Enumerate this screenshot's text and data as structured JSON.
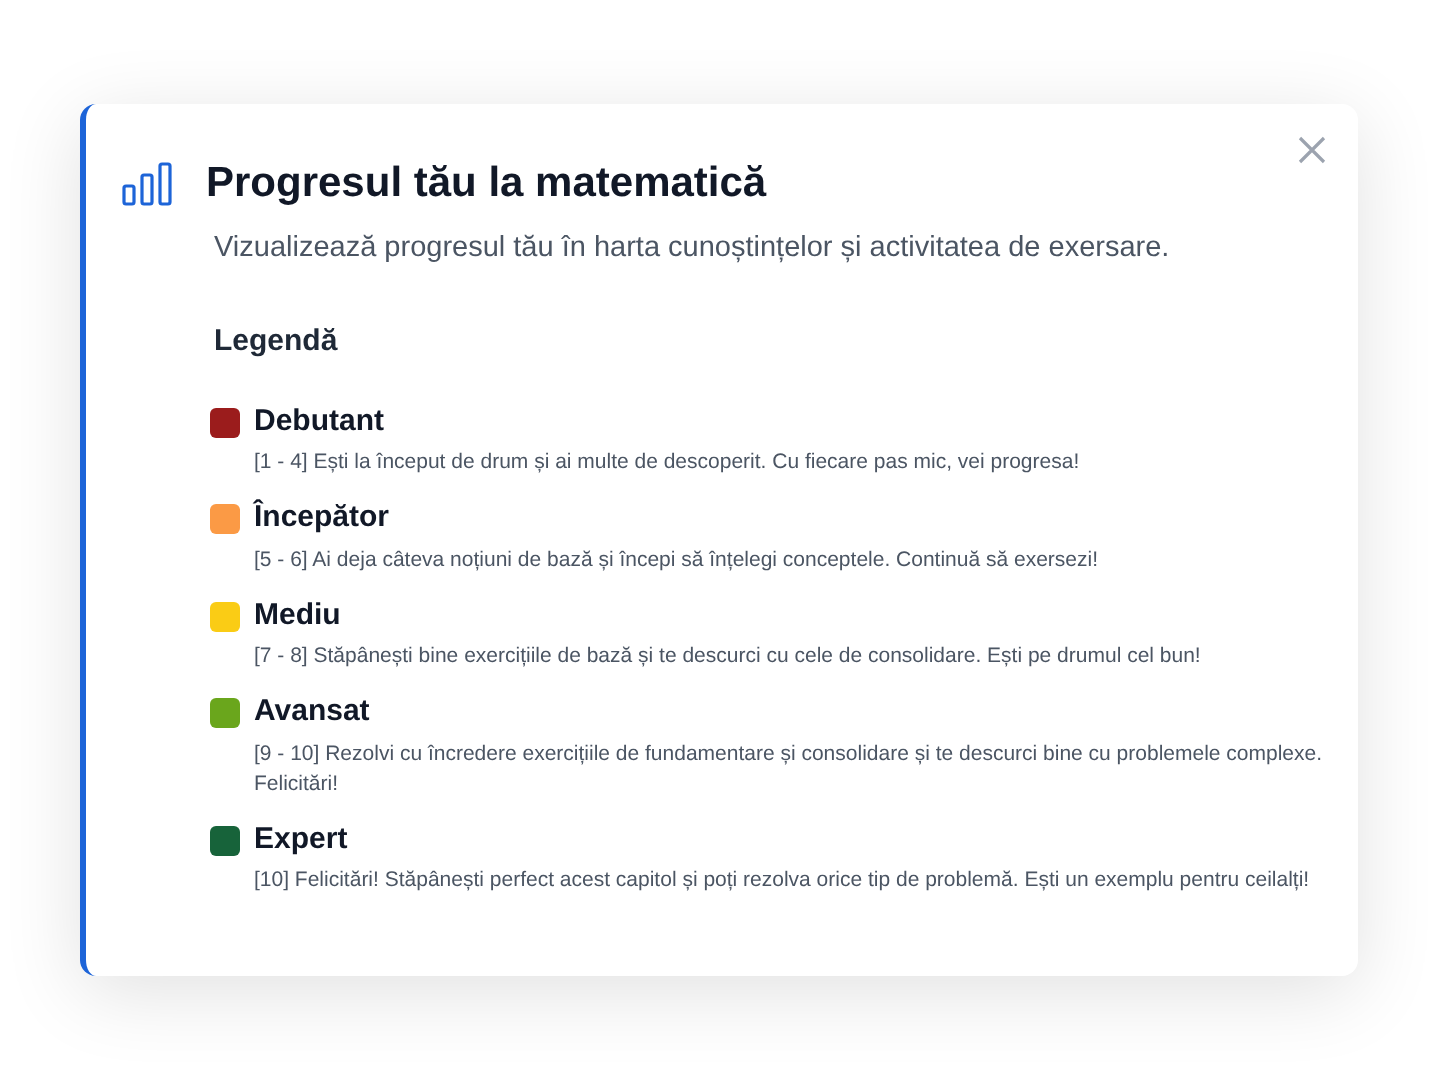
{
  "dialog": {
    "title": "Progresul tău la matematică",
    "subtitle": "Vizualizează progresul tău în harta cunoștințelor și activitatea de exersare.",
    "legend_title": "Legendă",
    "levels": [
      {
        "name": "Debutant",
        "color": "#9b1c1c",
        "description": "[1 - 4] Ești la început de drum și ai multe de descoperit. Cu fiecare pas mic, vei progresa!"
      },
      {
        "name": "Începător",
        "color": "#fb9a45",
        "description": "[5 - 6] Ai deja câteva noțiuni de bază și începi să înțelegi conceptele. Continuă să exersezi!"
      },
      {
        "name": "Mediu",
        "color": "#facc15",
        "description": "[7 - 8] Stăpânești bine exercițiile de bază și te descurci cu cele de consolidare. Ești pe drumul cel bun!"
      },
      {
        "name": "Avansat",
        "color": "#6aa61c",
        "description": "[9 - 10] Rezolvi cu încredere exercițiile de fundamentare și consolidare și te descurci bine cu problemele complexe. Felicitări!"
      },
      {
        "name": "Expert",
        "color": "#17633a",
        "description": "[10] Felicitări! Stăpânești perfect acest capitol și poți rezolva orice tip de problemă. Ești un exemplu pentru ceilalți!"
      }
    ]
  }
}
